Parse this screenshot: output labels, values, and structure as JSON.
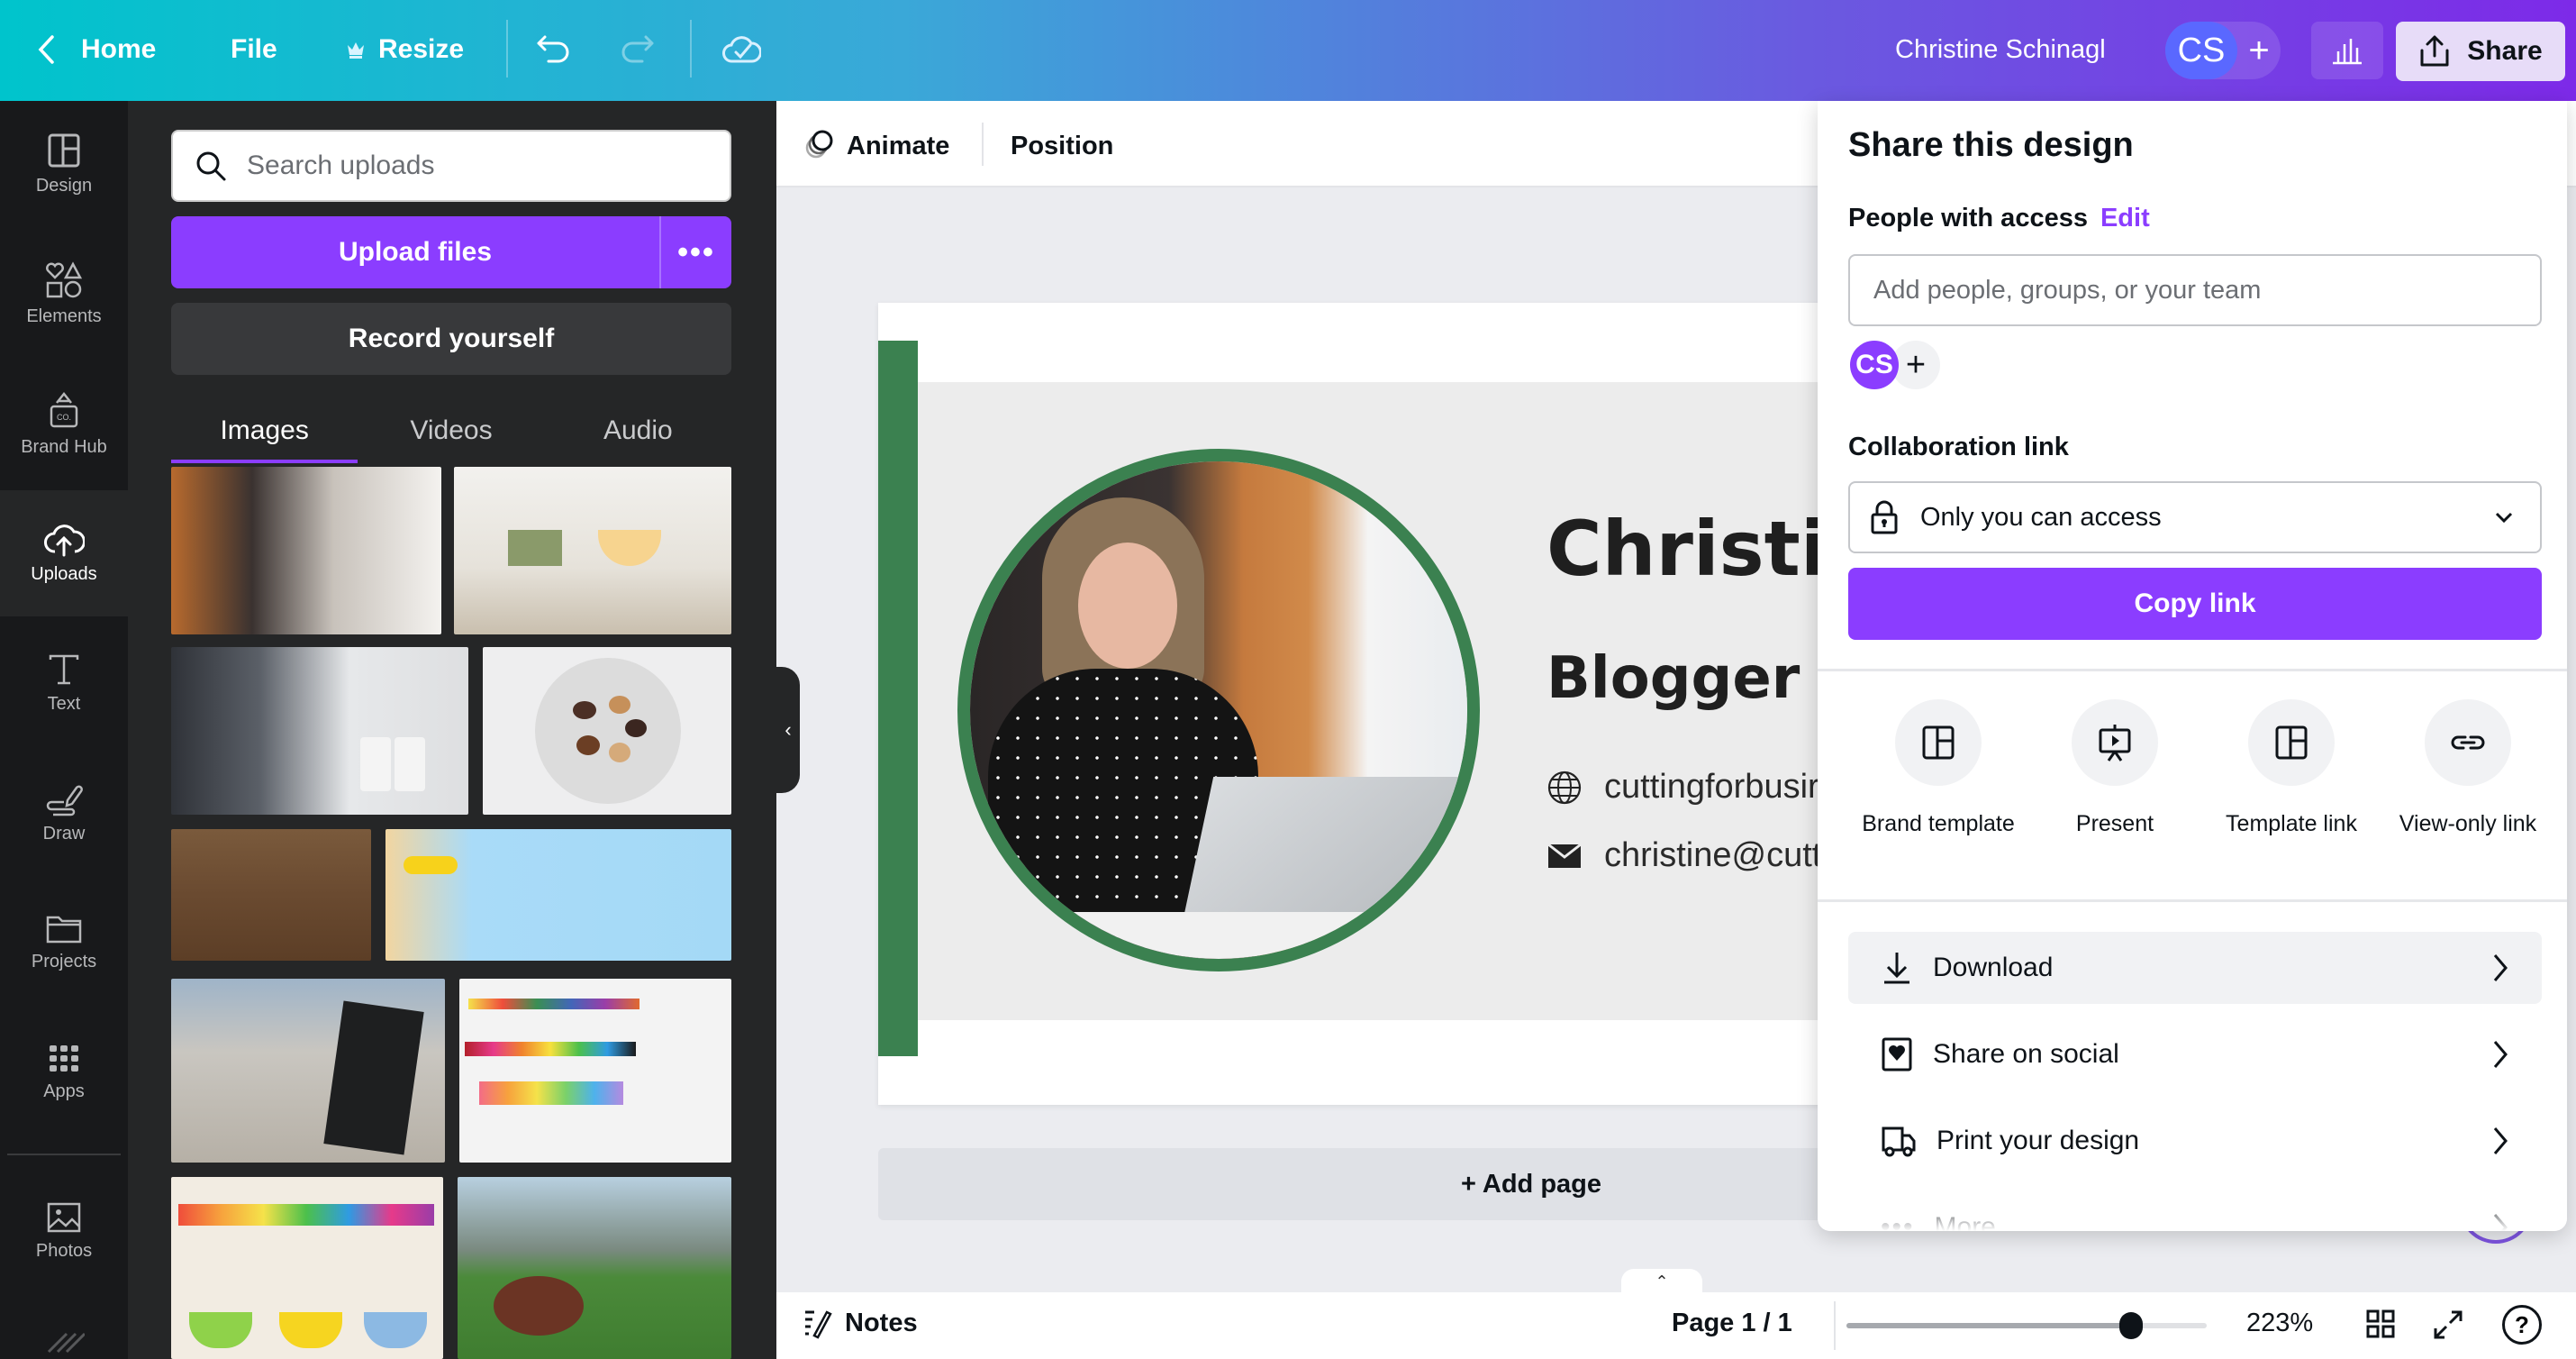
{
  "topbar": {
    "home_label": "Home",
    "file_label": "File",
    "resize_label": "Resize",
    "user_name": "Christine Schinagl",
    "avatar_initials": "CS",
    "share_label": "Share",
    "gradient_colors": [
      "#00c4cc",
      "#7d2ae8"
    ]
  },
  "rail": {
    "items": [
      {
        "label": "Design",
        "icon": "layout-icon"
      },
      {
        "label": "Elements",
        "icon": "shapes-icon"
      },
      {
        "label": "Brand Hub",
        "icon": "brand-hub-icon"
      },
      {
        "label": "Uploads",
        "icon": "cloud-upload-icon",
        "active": true
      },
      {
        "label": "Text",
        "icon": "text-icon"
      },
      {
        "label": "Draw",
        "icon": "draw-icon"
      },
      {
        "label": "Projects",
        "icon": "folder-icon"
      },
      {
        "label": "Apps",
        "icon": "apps-grid-icon"
      },
      {
        "label": "Photos",
        "icon": "photo-icon"
      }
    ]
  },
  "panel": {
    "search_placeholder": "Search uploads",
    "upload_label": "Upload files",
    "more_label": "•••",
    "record_label": "Record yourself",
    "tabs": [
      {
        "label": "Images",
        "active": true
      },
      {
        "label": "Videos"
      },
      {
        "label": "Audio"
      }
    ],
    "thumbnails": [
      "woman-laptop",
      "kitchen-counter",
      "laundry-room",
      "cookies-plate",
      "hiking-boots",
      "beach-sunglasses",
      "shop-local-sign",
      "paint-shelves",
      "craft-cubbies",
      "football-field"
    ]
  },
  "context_toolbar": {
    "animate_label": "Animate",
    "position_label": "Position"
  },
  "design": {
    "name": "Christine",
    "role": "Blogger",
    "website": "cuttingforbusir",
    "email": "christine@cutt",
    "accent_color": "#3b8150"
  },
  "canvas": {
    "add_page_label": "+ Add page"
  },
  "bottombar": {
    "notes_label": "Notes",
    "page_indicator": "Page 1 / 1",
    "zoom_level": "223%",
    "zoom_slider_fraction": 0.79
  },
  "share_panel": {
    "title": "Share this design",
    "people_label": "People with access",
    "edit_label": "Edit",
    "add_people_placeholder": "Add people, groups, or your team",
    "avatar_initials": "CS",
    "collab_label": "Collaboration link",
    "access_value": "Only you can access",
    "copy_link_label": "Copy link",
    "options": [
      {
        "label": "Brand template",
        "icon": "template-icon"
      },
      {
        "label": "Present",
        "icon": "present-icon"
      },
      {
        "label": "Template link",
        "icon": "template-icon"
      },
      {
        "label": "View-only link",
        "icon": "link-icon"
      }
    ],
    "rows": [
      {
        "label": "Download",
        "icon": "download-icon",
        "highlighted": true
      },
      {
        "label": "Share on social",
        "icon": "social-heart-icon"
      },
      {
        "label": "Print your design",
        "icon": "truck-icon"
      },
      {
        "label": "More",
        "icon": "more-dots-icon"
      }
    ],
    "accent_color": "#8b3dff"
  }
}
